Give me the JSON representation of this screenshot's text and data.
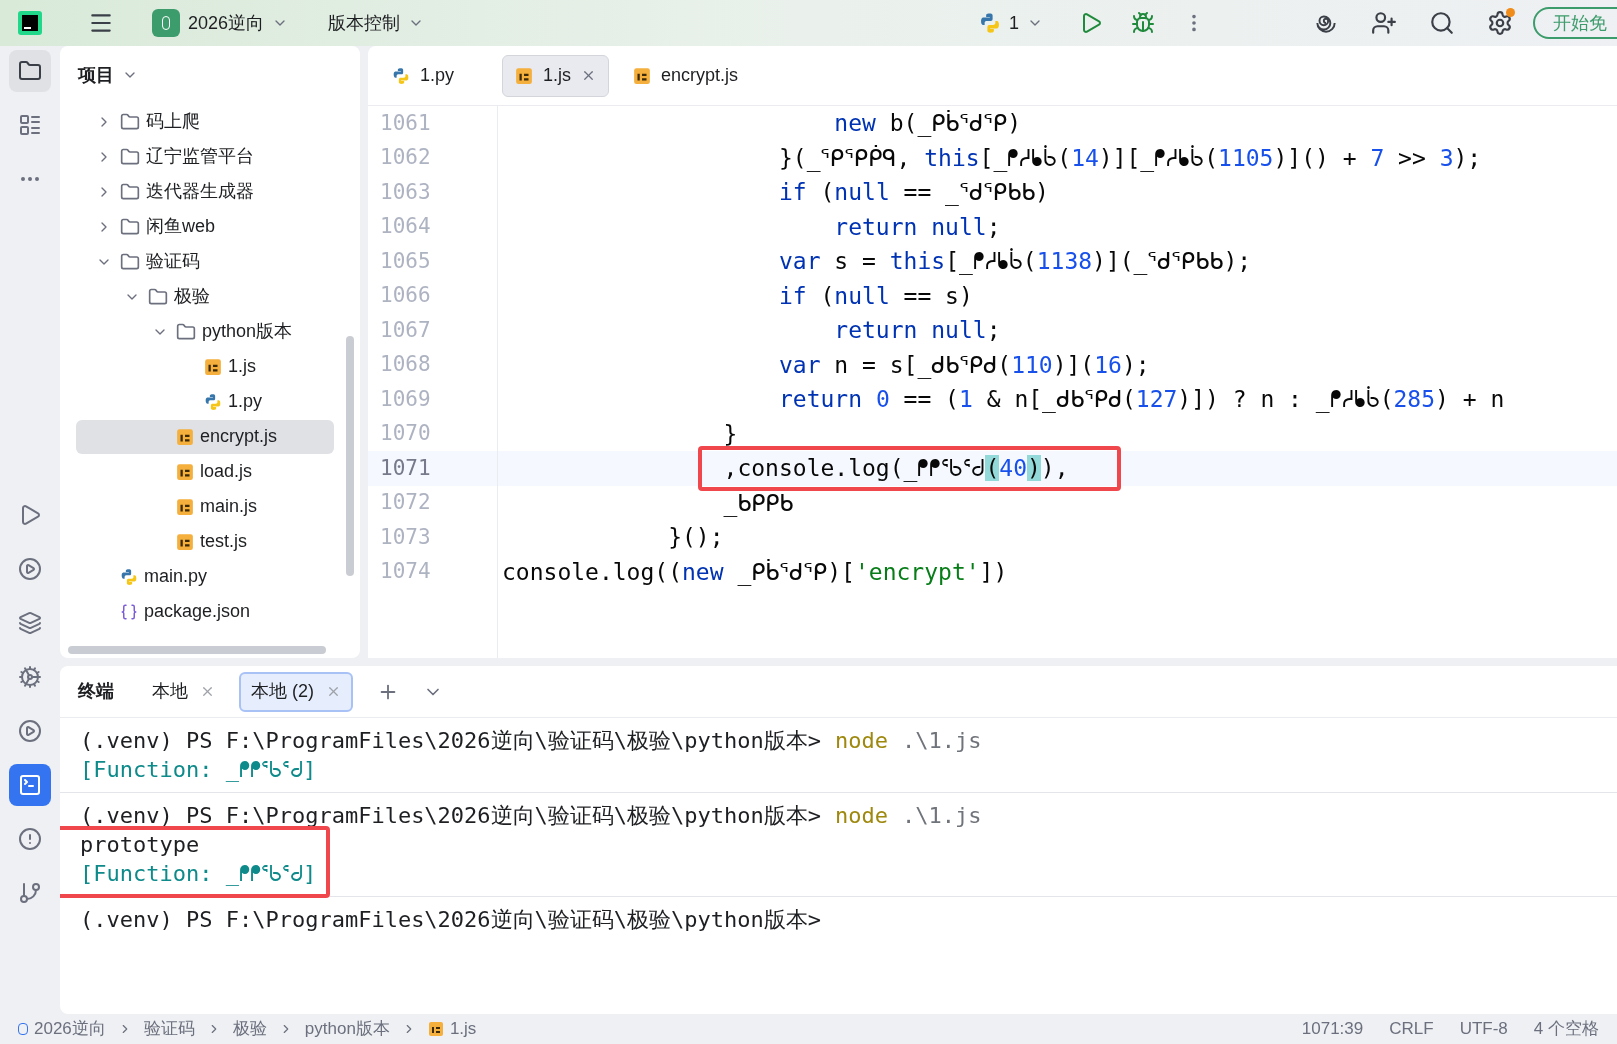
{
  "toolbar": {
    "project": "2026逆向",
    "vcs": "版本控制",
    "run_config": "1",
    "cta": "开始免"
  },
  "project_panel": {
    "title": "项目",
    "tree": [
      {
        "label": "码上爬",
        "kind": "folder",
        "expanded": false,
        "selected": false
      },
      {
        "label": "辽宁监管平台",
        "kind": "folder",
        "expanded": false,
        "selected": false
      },
      {
        "label": "迭代器生成器",
        "kind": "folder",
        "expanded": false,
        "selected": false
      },
      {
        "label": "闲鱼web",
        "kind": "folder",
        "expanded": false,
        "selected": false
      },
      {
        "label": "验证码",
        "kind": "folder",
        "expanded": true,
        "selected": false,
        "children": [
          {
            "label": "极验",
            "kind": "folder",
            "expanded": true,
            "selected": false,
            "children": [
              {
                "label": "python版本",
                "kind": "folder",
                "expanded": true,
                "selected": false,
                "children": [
                  {
                    "label": "1.js",
                    "kind": "js",
                    "selected": false
                  },
                  {
                    "label": "1.py",
                    "kind": "py",
                    "selected": false
                  }
                ]
              },
              {
                "label": "encrypt.js",
                "kind": "js",
                "selected": true
              },
              {
                "label": "load.js",
                "kind": "js",
                "selected": false
              },
              {
                "label": "main.js",
                "kind": "js",
                "selected": false
              },
              {
                "label": "test.js",
                "kind": "js",
                "selected": false
              }
            ]
          }
        ]
      },
      {
        "label": "main.py",
        "kind": "py",
        "selected": false
      },
      {
        "label": "package.json",
        "kind": "json",
        "selected": false
      }
    ]
  },
  "editor": {
    "tabs": [
      {
        "label": "1.py",
        "kind": "py",
        "selected": false
      },
      {
        "label": "1.js",
        "kind": "js",
        "selected": true
      },
      {
        "label": "encrypt.js",
        "kind": "js",
        "selected": false
      }
    ],
    "lines": [
      {
        "number": "1061",
        "tokens": [
          {
            "kind": "keyword",
            "text": "                        new"
          },
          {
            "kind": "plain",
            "text": " b(_ᑭᑳᕐᑯᕿ)"
          }
        ]
      },
      {
        "number": "1062",
        "tokens": [
          {
            "kind": "plain",
            "text": "                    }(_ᕿᕿᑮᑫ, "
          },
          {
            "kind": "keyword",
            "text": "this"
          },
          {
            "kind": "plain",
            "text": "[_ᖰᓱᖲᑳ("
          },
          {
            "kind": "number",
            "text": "14"
          },
          {
            "kind": "plain",
            "text": ")][_ᖰᓱᖲᑳ("
          },
          {
            "kind": "number",
            "text": "1105"
          },
          {
            "kind": "plain",
            "text": ")]() + "
          },
          {
            "kind": "number",
            "text": "7"
          },
          {
            "kind": "plain",
            "text": " >> "
          },
          {
            "kind": "number",
            "text": "3"
          },
          {
            "kind": "plain",
            "text": ");"
          }
        ]
      },
      {
        "number": "1063",
        "tokens": [
          {
            "kind": "keyword",
            "text": "                    if"
          },
          {
            "kind": "plain",
            "text": " ("
          },
          {
            "kind": "keyword",
            "text": "null"
          },
          {
            "kind": "plain",
            "text": " == _ᕐᑯᕿᑲᑲ)"
          }
        ]
      },
      {
        "number": "1064",
        "tokens": [
          {
            "kind": "keyword",
            "text": "                        return null"
          },
          {
            "kind": "plain",
            "text": ";"
          }
        ]
      },
      {
        "number": "1065",
        "tokens": [
          {
            "kind": "keyword",
            "text": "                    var"
          },
          {
            "kind": "plain",
            "text": " s = "
          },
          {
            "kind": "keyword",
            "text": "this"
          },
          {
            "kind": "plain",
            "text": "[_ᖰᓱᖲᑳ("
          },
          {
            "kind": "number",
            "text": "1138"
          },
          {
            "kind": "plain",
            "text": ")](_ᕐᑯᕿᑲᑲ);"
          }
        ]
      },
      {
        "number": "1066",
        "tokens": [
          {
            "kind": "keyword",
            "text": "                    if"
          },
          {
            "kind": "plain",
            "text": " ("
          },
          {
            "kind": "keyword",
            "text": "null"
          },
          {
            "kind": "plain",
            "text": " == s)"
          }
        ]
      },
      {
        "number": "1067",
        "tokens": [
          {
            "kind": "keyword",
            "text": "                        return null"
          },
          {
            "kind": "plain",
            "text": ";"
          }
        ]
      },
      {
        "number": "1068",
        "tokens": [
          {
            "kind": "keyword",
            "text": "                    var"
          },
          {
            "kind": "plain",
            "text": " n = s[_ᑯᑲᕿᑯ("
          },
          {
            "kind": "number",
            "text": "110"
          },
          {
            "kind": "plain",
            "text": ")]("
          },
          {
            "kind": "number",
            "text": "16"
          },
          {
            "kind": "plain",
            "text": ");"
          }
        ]
      },
      {
        "number": "1069",
        "tokens": [
          {
            "kind": "keyword",
            "text": "                    return"
          },
          {
            "kind": "number",
            "text": " 0"
          },
          {
            "kind": "plain",
            "text": " == ("
          },
          {
            "kind": "number",
            "text": "1"
          },
          {
            "kind": "plain",
            "text": " & n[_ᑯᑲᕿᑯ("
          },
          {
            "kind": "number",
            "text": "127"
          },
          {
            "kind": "plain",
            "text": ")]) ? n : _ᖰᓱᖲᑳ("
          },
          {
            "kind": "number",
            "text": "285"
          },
          {
            "kind": "plain",
            "text": ") + n"
          }
        ]
      },
      {
        "number": "1070",
        "tokens": [
          {
            "kind": "plain",
            "text": "                }"
          }
        ]
      },
      {
        "number": "1071",
        "current": true,
        "boxed": true,
        "tokens": [
          {
            "kind": "plain",
            "text": "                ,console.log(_ᖰᖰᕐᑲᕐᑯ"
          },
          {
            "kind": "match",
            "text": "("
          },
          {
            "kind": "number",
            "text": "40"
          },
          {
            "kind": "match",
            "text": ")"
          },
          {
            "kind": "plain",
            "text": "),"
          }
        ]
      },
      {
        "number": "1072",
        "tokens": [
          {
            "kind": "plain",
            "text": "                _ᑲᑭᑭᑲ"
          }
        ]
      },
      {
        "number": "1073",
        "tokens": [
          {
            "kind": "plain",
            "text": "            }();"
          }
        ]
      },
      {
        "number": "1074",
        "tokens": [
          {
            "kind": "plain",
            "text": "console.log(("
          },
          {
            "kind": "keyword",
            "text": "new"
          },
          {
            "kind": "plain",
            "text": " _ᑭᑳᕐᑯᕿ)["
          },
          {
            "kind": "string",
            "text": "'encrypt'"
          },
          {
            "kind": "plain",
            "text": "])"
          }
        ]
      }
    ]
  },
  "terminal": {
    "title": "终端",
    "tabs": [
      {
        "label": "本地",
        "selected": false
      },
      {
        "label": "本地 (2)",
        "selected": true
      }
    ],
    "blocks": [
      {
        "prompt": "(.venv) PS F:\\ProgramFiles\\2026逆向\\验证码\\极验\\python版本>",
        "command": "node",
        "args": ".\\1.js",
        "output": [
          {
            "kind": "result",
            "text": "[Function: _ᖰᖰᕐᑲᕐᑯ]"
          }
        ]
      },
      {
        "prompt": "(.venv) PS F:\\ProgramFiles\\2026逆向\\验证码\\极验\\python版本>",
        "command": "node",
        "args": ".\\1.js",
        "boxed": true,
        "output": [
          {
            "kind": "plain",
            "text": "prototype"
          },
          {
            "kind": "result",
            "text": "[Function: _ᖰᖰᕐᑲᕐᑯ]"
          }
        ]
      },
      {
        "prompt": "(.venv) PS F:\\ProgramFiles\\2026逆向\\验证码\\极验\\python版本>"
      }
    ]
  },
  "status_bar": {
    "breadcrumbs": [
      {
        "label": "2026逆向",
        "kind": "folder"
      },
      {
        "label": "验证码",
        "kind": "plain"
      },
      {
        "label": "极验",
        "kind": "plain"
      },
      {
        "label": "python版本",
        "kind": "plain"
      },
      {
        "label": "1.js",
        "kind": "js"
      }
    ],
    "items": [
      "1071:39",
      "CRLF",
      "UTF-8",
      "4 个空格"
    ]
  }
}
